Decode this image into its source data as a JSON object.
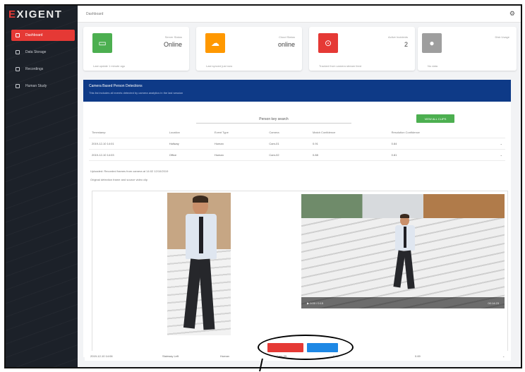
{
  "app": {
    "logo_prefix": "E",
    "logo_rest": "XIGENT"
  },
  "topbar": {
    "breadcrumb": "Dashboard",
    "settings_icon": "gear-icon"
  },
  "sidebar": {
    "items": [
      {
        "label": "Dashboard",
        "icon": "grid-icon",
        "active": true
      },
      {
        "label": "Data Storage",
        "icon": "storage-icon",
        "active": false
      },
      {
        "label": "Recordings",
        "icon": "people-icon",
        "active": false
      },
      {
        "label": "Human Study",
        "icon": "pin-icon",
        "active": false
      }
    ]
  },
  "cards": [
    {
      "label": "Server Status",
      "value": "Online",
      "footer": "Last update 1 minute ago",
      "color": "#4caf50",
      "icon": "monitor-icon"
    },
    {
      "label": "Cloud Status",
      "value": "online",
      "footer": "Last synced just now",
      "color": "#ff9800",
      "icon": "cloud-icon"
    },
    {
      "label": "Active Incidents",
      "value": "2",
      "footer": "Tracked from camera stream feed",
      "color": "#e53935",
      "icon": "alert-icon"
    },
    {
      "label": "Disk Usage",
      "value": "",
      "footer": "No data",
      "color": "#9e9e9e",
      "icon": "disk-icon"
    }
  ],
  "banner": {
    "title": "Camera Based Person Detections",
    "subtitle": "This list includes all events detected by camera analytics in the last session"
  },
  "content": {
    "reference_field": "Person key search",
    "green_button": "VIEW ALL CLIPS",
    "table": {
      "headers": [
        "Timestamp",
        "Location",
        "Event Type",
        "Camera",
        "Match Confidence",
        "Resolution Confidence"
      ],
      "rows": [
        [
          "2019-12-10 14:01",
          "Hallway",
          "Human",
          "Cam-01",
          "0.91",
          "0.84"
        ],
        [
          "2019-12-10 14:03",
          "Office",
          "Human",
          "Cam-02",
          "0.88",
          "0.81"
        ]
      ]
    },
    "info_line_1": "Uploaded: Recorded frames from camera at 14:02 12/10/2019",
    "info_line_2": "Original detection frame and source video clip",
    "video": {
      "time": "0:00 / 0:15",
      "stamp": "00:14:23"
    }
  },
  "bottom_row": [
    "2019-12-10 14:06",
    "Stairway Left",
    "Human",
    "Cam-05",
    "0.78",
    "0.69"
  ]
}
